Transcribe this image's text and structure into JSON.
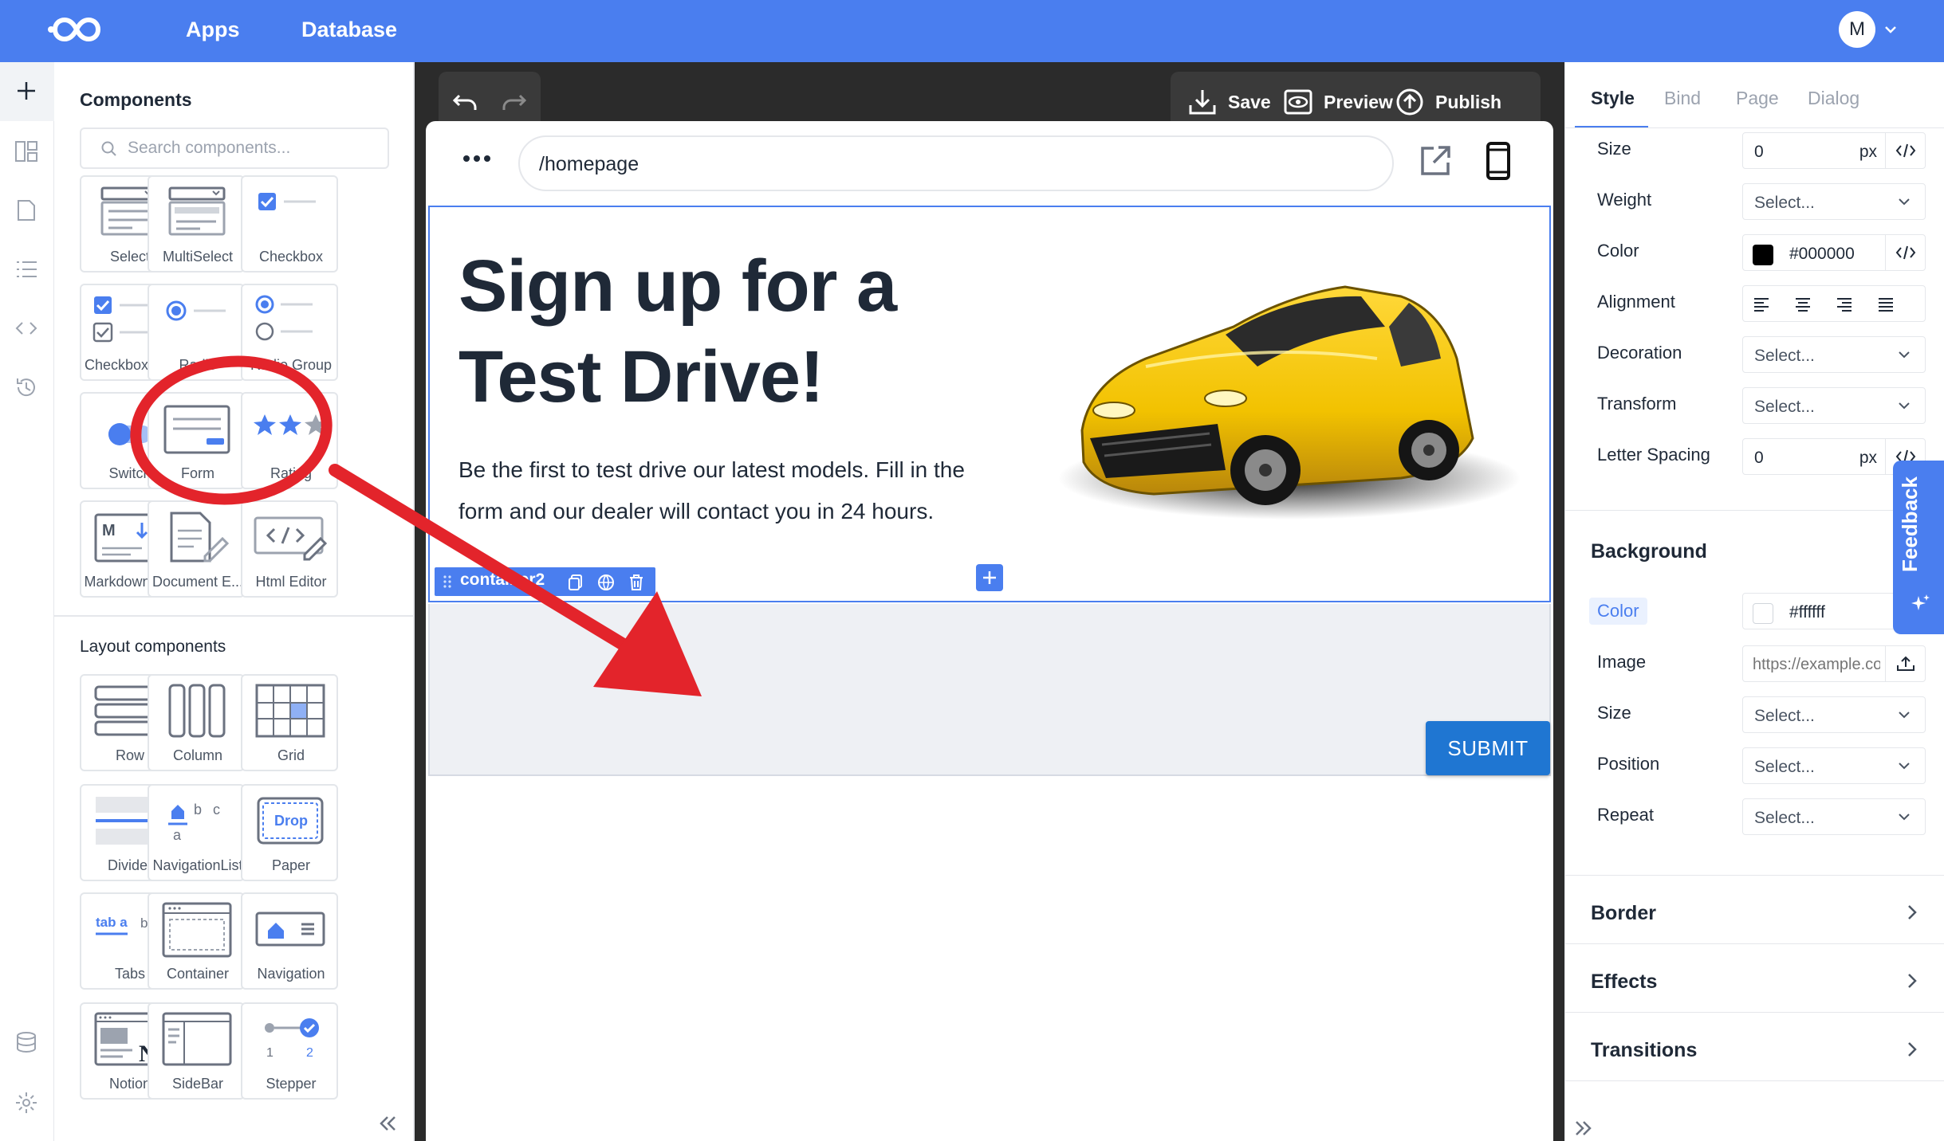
{
  "nav": {
    "apps": "Apps",
    "database": "Database",
    "avatar_initial": "M"
  },
  "components_panel": {
    "title": "Components",
    "search_placeholder": "Search components...",
    "tiles": [
      {
        "label": "Select",
        "icon": "select-icon"
      },
      {
        "label": "MultiSelect",
        "icon": "multiselect-icon"
      },
      {
        "label": "Checkbox",
        "icon": "checkbox-icon"
      },
      {
        "label": "Checkbox G...",
        "icon": "checkbox-group-icon"
      },
      {
        "label": "Radio",
        "icon": "radio-icon"
      },
      {
        "label": "Radio Group",
        "icon": "radio-group-icon"
      },
      {
        "label": "Switch",
        "icon": "switch-icon"
      },
      {
        "label": "Form",
        "icon": "form-icon"
      },
      {
        "label": "Rating",
        "icon": "rating-icon"
      },
      {
        "label": "Markdown E...",
        "icon": "markdown-editor-icon"
      },
      {
        "label": "Document E...",
        "icon": "document-editor-icon"
      },
      {
        "label": "Html Editor",
        "icon": "html-editor-icon"
      }
    ],
    "layout_title": "Layout components",
    "layout_tiles": [
      {
        "label": "Row",
        "icon": "row-icon"
      },
      {
        "label": "Column",
        "icon": "column-icon"
      },
      {
        "label": "Grid",
        "icon": "grid-icon"
      },
      {
        "label": "Divider",
        "icon": "divider-icon"
      },
      {
        "label": "NavigationList",
        "icon": "navigation-list-icon"
      },
      {
        "label": "Paper",
        "icon": "paper-icon",
        "inner_text": "Drop"
      },
      {
        "label": "Tabs",
        "icon": "tabs-icon",
        "inner_text": "tab a"
      },
      {
        "label": "Container",
        "icon": "container-icon"
      },
      {
        "label": "Navigation",
        "icon": "navigation-icon"
      },
      {
        "label": "Notion",
        "icon": "notion-icon"
      },
      {
        "label": "SideBar",
        "icon": "sidebar-icon"
      },
      {
        "label": "Stepper",
        "icon": "stepper-icon"
      }
    ]
  },
  "toolbar": {
    "save": "Save",
    "preview": "Preview",
    "publish": "Publish"
  },
  "canvas": {
    "url": "/homepage",
    "headline": "Sign up for a Test Drive!",
    "paragraph": "Be the first to test drive our latest models. Fill in the form and our dealer will contact you in 24 hours.",
    "container_tag": "container2",
    "submit_label": "SUBMIT"
  },
  "properties": {
    "tabs": [
      "Style",
      "Bind",
      "Page",
      "Dialog"
    ],
    "active_tab": "Style",
    "typography": {
      "size_label": "Size",
      "size_value": "0",
      "size_unit": "px",
      "weight_label": "Weight",
      "weight_value": "Select...",
      "color_label": "Color",
      "color_value": "#000000",
      "alignment_label": "Alignment",
      "decoration_label": "Decoration",
      "decoration_value": "Select...",
      "transform_label": "Transform",
      "transform_value": "Select...",
      "letter_spacing_label": "Letter Spacing",
      "letter_spacing_value": "0",
      "letter_spacing_unit": "px"
    },
    "background": {
      "title": "Background",
      "color_label": "Color",
      "color_value": "#ffffff",
      "image_label": "Image",
      "image_placeholder": "https://example.com",
      "size_label": "Size",
      "size_value": "Select...",
      "position_label": "Position",
      "position_value": "Select...",
      "repeat_label": "Repeat",
      "repeat_value": "Select..."
    },
    "sections": [
      "Border",
      "Effects",
      "Transitions"
    ],
    "feedback": "Feedback"
  },
  "colors": {
    "brand": "#4a7eef",
    "annotation": "#e3242b",
    "submit": "#1f76d2",
    "car": "#f2c200"
  }
}
